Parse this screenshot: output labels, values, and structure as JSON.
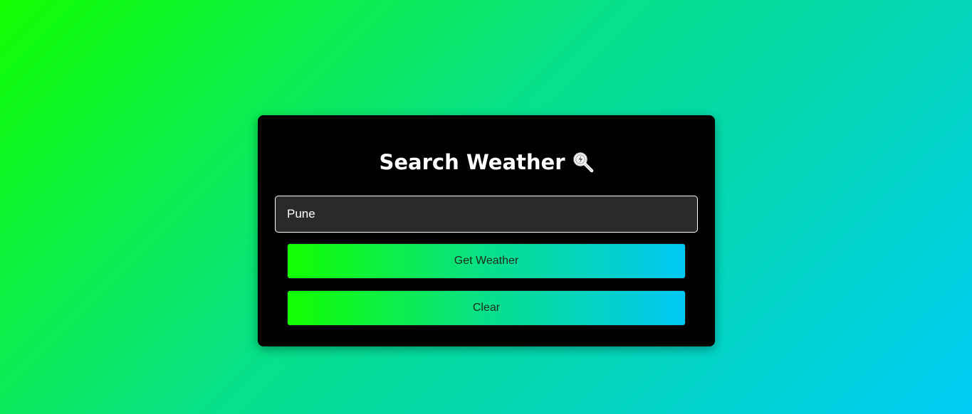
{
  "app": {
    "title": "Search Weather",
    "title_icon": "magnifier-lightning-icon"
  },
  "search": {
    "value": "Pune",
    "placeholder": ""
  },
  "buttons": {
    "get_weather_label": "Get Weather",
    "clear_label": "Clear"
  },
  "colors": {
    "background_gradient": [
      "#12ff00",
      "#07e08a",
      "#00cbf5"
    ],
    "card": "#000000",
    "input_bg": "#2a2a2a",
    "title_text": "#ffffff"
  }
}
